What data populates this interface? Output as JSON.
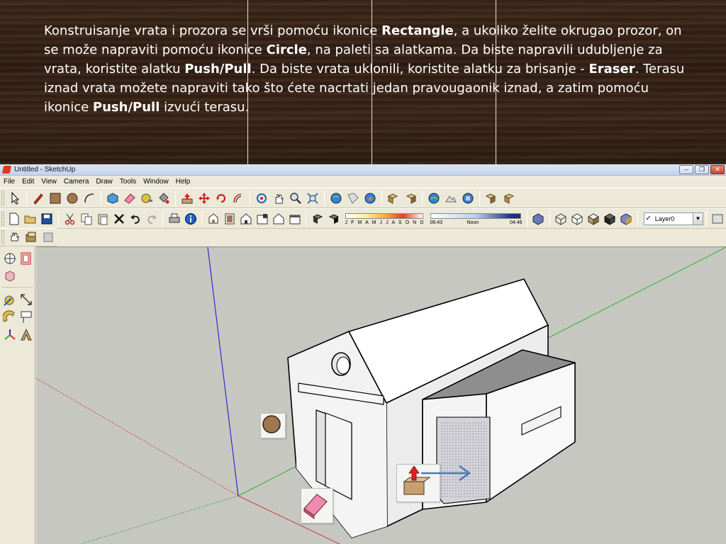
{
  "caption": {
    "p1": "Konstruisanje vrata i prozora se vrši pomoću ikonice ",
    "b1": "Rectangle",
    "p2": ", a ukoliko želite okrugao prozor, on se može napraviti pomoću ikonice ",
    "b2": "Circle",
    "p3": ", na paleti sa alatkama. Da biste napravili udubljenje za vrata, koristite alatku ",
    "b3": "Push/Pull",
    "p4": ". Da biste vrata uklonili, koristite alatku za brisanje - ",
    "b4": "Eraser",
    "p5": ". Terasu iznad vrata možete napraviti tako što ćete nacrtati jedan pravougaonik iznad, a zatim pomoću ikonice ",
    "b5": "Push/Pull",
    "p6": " izvući terasu."
  },
  "window": {
    "title": "Untitled - SketchUp",
    "minimize": "–",
    "restore": "❐",
    "close": "✕"
  },
  "menu": [
    "File",
    "Edit",
    "View",
    "Camera",
    "Draw",
    "Tools",
    "Window",
    "Help"
  ],
  "shadows": {
    "months": "J F M A M J J A S O N D",
    "time_start": "06:43",
    "time_mid": "Noon",
    "time_end": "04:46"
  },
  "layer": {
    "check": "✓",
    "value": "Layer0",
    "arrow": "▼"
  },
  "colors": {
    "wood": "#3a2416",
    "viewport": "#c7c7c2",
    "axis_red": "#c83c3c",
    "axis_green": "#30b030",
    "axis_blue": "#2a2ad0"
  }
}
